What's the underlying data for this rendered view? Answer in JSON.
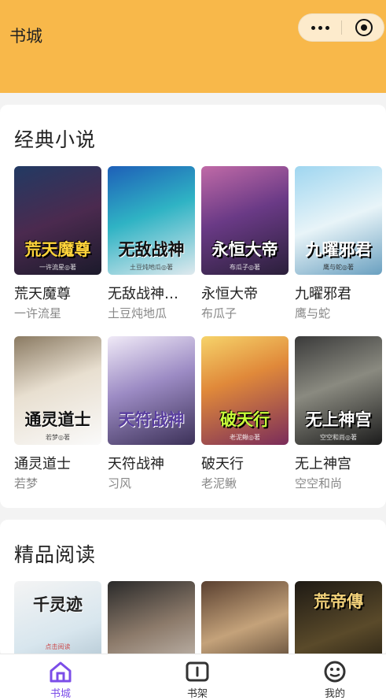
{
  "header": {
    "title": "书城"
  },
  "sections": [
    {
      "title": "经典小说",
      "books": [
        {
          "name": "荒天魔尊",
          "author": "一许流星",
          "cover_text": "荒天魔尊",
          "cover_sub": "一许流星◎著"
        },
        {
          "name": "无敌战神…",
          "author": "土豆炖地瓜",
          "cover_text": "无敌战神",
          "cover_sub": "土豆炖地瓜◎著"
        },
        {
          "name": "永恒大帝",
          "author": "布瓜子",
          "cover_text": "永恒大帝",
          "cover_sub": "布瓜子◎著"
        },
        {
          "name": "九曜邪君",
          "author": "鹰与蛇",
          "cover_text": "九曜邪君",
          "cover_sub": "鹰与蛇◎著"
        },
        {
          "name": "通灵道士",
          "author": "若梦",
          "cover_text": "通灵道士",
          "cover_sub": "若梦◎著"
        },
        {
          "name": "天符战神",
          "author": "习风",
          "cover_text": "天符战神",
          "cover_sub": ""
        },
        {
          "name": "破天行",
          "author": "老泥鳅",
          "cover_text": "破天行",
          "cover_sub": "老泥鳅◎著"
        },
        {
          "name": "无上神宫",
          "author": "空空和尚",
          "cover_text": "无上神宫",
          "cover_sub": "空空和尚◎著"
        }
      ]
    },
    {
      "title": "精品阅读",
      "books": [
        {
          "cover_text": "千灵迹",
          "cover_sub": "点击阅读"
        },
        {
          "cover_text": "",
          "cover_sub": ""
        },
        {
          "cover_text": "",
          "cover_sub": ""
        },
        {
          "cover_text": "荒帝傳",
          "cover_sub": ""
        }
      ]
    }
  ],
  "tabbar": [
    {
      "label": "书城",
      "icon": "home-icon",
      "active": true
    },
    {
      "label": "书架",
      "icon": "bookshelf-icon",
      "active": false
    },
    {
      "label": "我的",
      "icon": "profile-icon",
      "active": false
    }
  ],
  "colors": {
    "header_bg": "#f8b84a",
    "active_tab": "#7b4de8"
  }
}
